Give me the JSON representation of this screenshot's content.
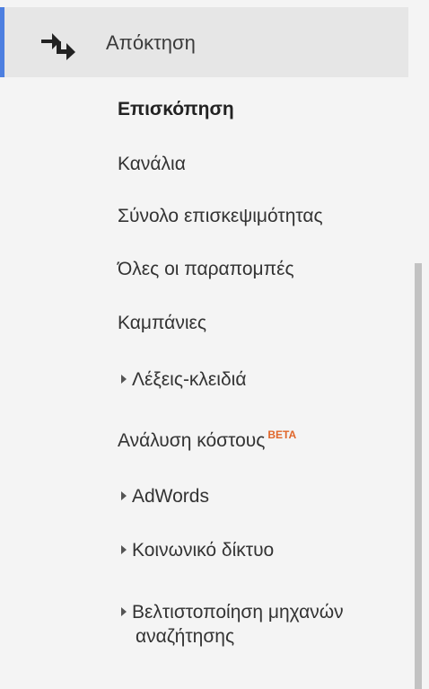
{
  "section": {
    "icon": "acquisition-arrows-icon",
    "title": "Απόκτηση"
  },
  "nav": {
    "overview": "Επισκόπηση",
    "channels": "Κανάλια",
    "all_traffic": "Σύνολο επισκεψιμότητας",
    "all_referrals": "Όλες οι παραπομπές",
    "campaigns": "Καμπάνιες",
    "keywords": "Λέξεις-κλειδιά",
    "cost_analysis": "Ανάλυση κόστους",
    "cost_analysis_badge": "BETA",
    "adwords": "AdWords",
    "social": "Κοινωνικό δίκτυο",
    "seo_line1": "Βελτιστοποίηση μηχανών",
    "seo_line2": "αναζήτησης"
  },
  "colors": {
    "accent": "#4d7fe0",
    "badge": "#e0662a",
    "header_bg": "#e6e6e6",
    "panel_bg": "#f4f4f4"
  }
}
